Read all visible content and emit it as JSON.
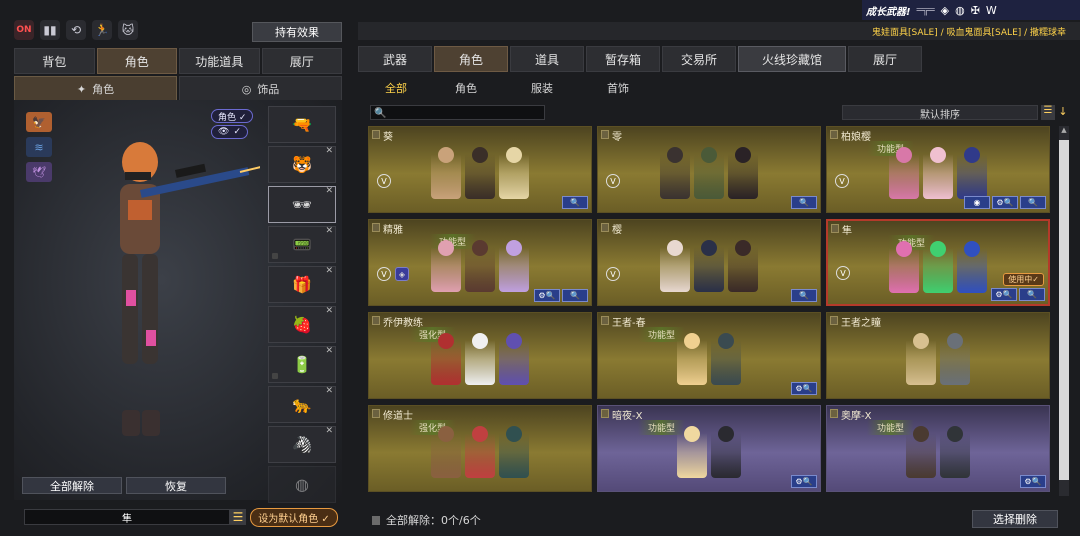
{
  "topbar": {
    "on_label": "ON",
    "effects_button": "持有效果",
    "banner_title": "成长武器!",
    "marquee": "鬼娃面具[SALE] / 吸血鬼面具[SALE] / 撒糯球幸"
  },
  "left_tabs": [
    "背包",
    "角色",
    "功能道具",
    "展厅"
  ],
  "left_subtabs": [
    "角色",
    "饰品"
  ],
  "char_pills": {
    "role": "角色 ✓",
    "eye": "✓"
  },
  "slots": [
    "🔫",
    "🐯",
    "🕶",
    "📟",
    "🎁",
    "🍓",
    "🔋",
    "🐆",
    "🦓",
    "◍"
  ],
  "left_buttons": {
    "unequip_all": "全部解除",
    "restore": "恢复"
  },
  "name_field": {
    "value": "隼",
    "set_default": "设为默认角色 ✓"
  },
  "right_tabs": [
    "武器",
    "角色",
    "道具",
    "暂存箱",
    "交易所",
    "火线珍藏馆",
    "展厅"
  ],
  "right_subtabs": [
    "全部",
    "角色",
    "服装",
    "首饰"
  ],
  "sort_label": "默认排序",
  "cards": [
    {
      "name": "葵",
      "badge": "",
      "style": "gold",
      "v": true,
      "blue": false,
      "actions": [
        "🔍"
      ],
      "colors": [
        "#c9a27a",
        "#3a2e28",
        "#e6d6a6"
      ]
    },
    {
      "name": "零",
      "badge": "",
      "style": "gold",
      "v": true,
      "blue": false,
      "actions": [
        "🔍"
      ],
      "colors": [
        "#3a3230",
        "#4a5a38",
        "#2a2226"
      ]
    },
    {
      "name": "柏娘樱",
      "badge": "功能型",
      "style": "gold",
      "v": true,
      "blue": false,
      "actions": [
        "◉",
        "⚙🔍",
        "🔍"
      ],
      "colors": [
        "#d878a8",
        "#f0c0d0",
        "#303a8a"
      ]
    },
    {
      "name": "精雅",
      "badge": "功能型",
      "style": "gold",
      "v": true,
      "blue": true,
      "actions": [
        "⚙🔍",
        "🔍"
      ],
      "colors": [
        "#e0a0b0",
        "#5a3a30",
        "#c0a0e0"
      ]
    },
    {
      "name": "樱",
      "badge": "",
      "style": "gold",
      "v": true,
      "blue": false,
      "actions": [
        "🔍"
      ],
      "colors": [
        "#e8d8d0",
        "#2a3048",
        "#3a2a28"
      ]
    },
    {
      "name": "隼",
      "badge": "功能型",
      "style": "gold",
      "v": true,
      "blue": false,
      "selected": true,
      "in_use": "使用中✓",
      "actions": [
        "⚙🔍",
        "🔍"
      ],
      "colors": [
        "#e070b0",
        "#40d070",
        "#3050c0"
      ]
    },
    {
      "name": "乔伊教练",
      "badge": "强化型",
      "style": "gold",
      "v": false,
      "blue": false,
      "actions": [],
      "colors": [
        "#b03030",
        "#f0f0f0",
        "#6050b0"
      ]
    },
    {
      "name": "王者-春",
      "badge": "功能型",
      "style": "gold",
      "v": false,
      "blue": false,
      "actions": [
        "⚙🔍"
      ],
      "colors": [
        "#f0d090",
        "#3a4a50"
      ]
    },
    {
      "name": "王者之瞳",
      "badge": "",
      "style": "gold",
      "v": false,
      "blue": false,
      "actions": [],
      "colors": [
        "#d8c090",
        "#6a7078"
      ]
    },
    {
      "name": "修道士",
      "badge": "强化型",
      "style": "gold",
      "v": false,
      "blue": false,
      "actions": [],
      "colors": [
        "#8a6040",
        "#c04040",
        "#305050"
      ]
    },
    {
      "name": "暗夜-X",
      "badge": "功能型",
      "style": "purple",
      "v": false,
      "blue": false,
      "actions": [
        "⚙🔍"
      ],
      "colors": [
        "#f0d8a0",
        "#2a2a30"
      ]
    },
    {
      "name": "奥摩-X",
      "badge": "功能型",
      "style": "purple",
      "v": false,
      "blue": false,
      "actions": [
        "⚙🔍"
      ],
      "colors": [
        "#4a3a30",
        "#303438"
      ]
    }
  ],
  "footer": {
    "unequip_count": "全部解除：0个/6个",
    "select_delete": "选择删除"
  }
}
